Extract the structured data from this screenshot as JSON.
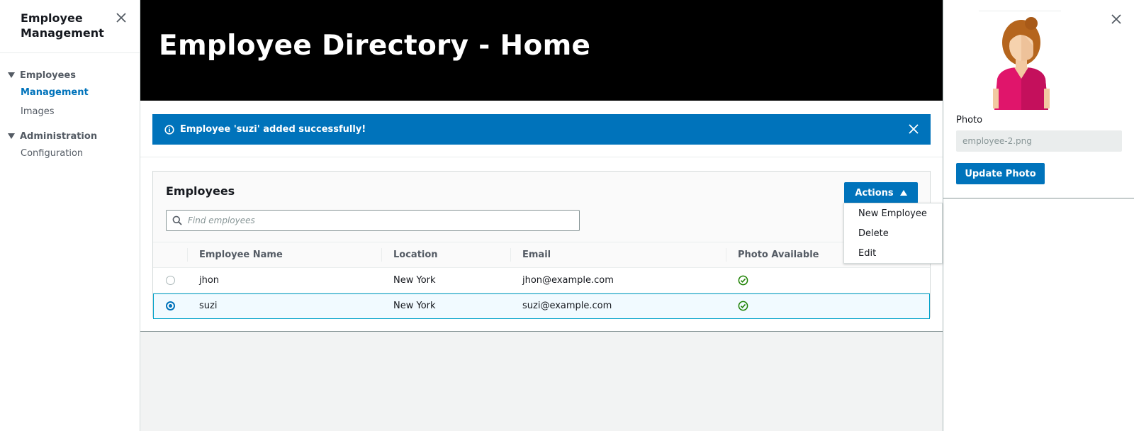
{
  "nav": {
    "title": "Employee Management",
    "sections": [
      {
        "label": "Employees",
        "items": [
          {
            "label": "Management",
            "active": true
          },
          {
            "label": "Images",
            "active": false
          }
        ]
      },
      {
        "label": "Administration",
        "items": [
          {
            "label": "Configuration",
            "active": false
          }
        ]
      }
    ]
  },
  "header": {
    "title": "Employee Directory - Home"
  },
  "flash": {
    "message": "Employee 'suzi' added successfully!",
    "icon": "info-icon"
  },
  "panel": {
    "title": "Employees",
    "search_placeholder": "Find employees",
    "actions_label": "Actions",
    "actions_menu": [
      "New Employee",
      "Delete",
      "Edit"
    ]
  },
  "table": {
    "columns": [
      "Employee Name",
      "Location",
      "Email",
      "Photo Available"
    ],
    "rows": [
      {
        "name": "jhon",
        "location": "New York",
        "email": "jhon@example.com",
        "photo_available": true,
        "selected": false
      },
      {
        "name": "suzi",
        "location": "New York",
        "email": "suzi@example.com",
        "photo_available": true,
        "selected": true
      }
    ]
  },
  "drawer": {
    "photo_label": "Photo",
    "photo_value": "employee-2.png",
    "update_label": "Update Photo"
  },
  "colors": {
    "accent": "#0073bb",
    "header_bg": "#000000",
    "success": "#1d8102"
  }
}
